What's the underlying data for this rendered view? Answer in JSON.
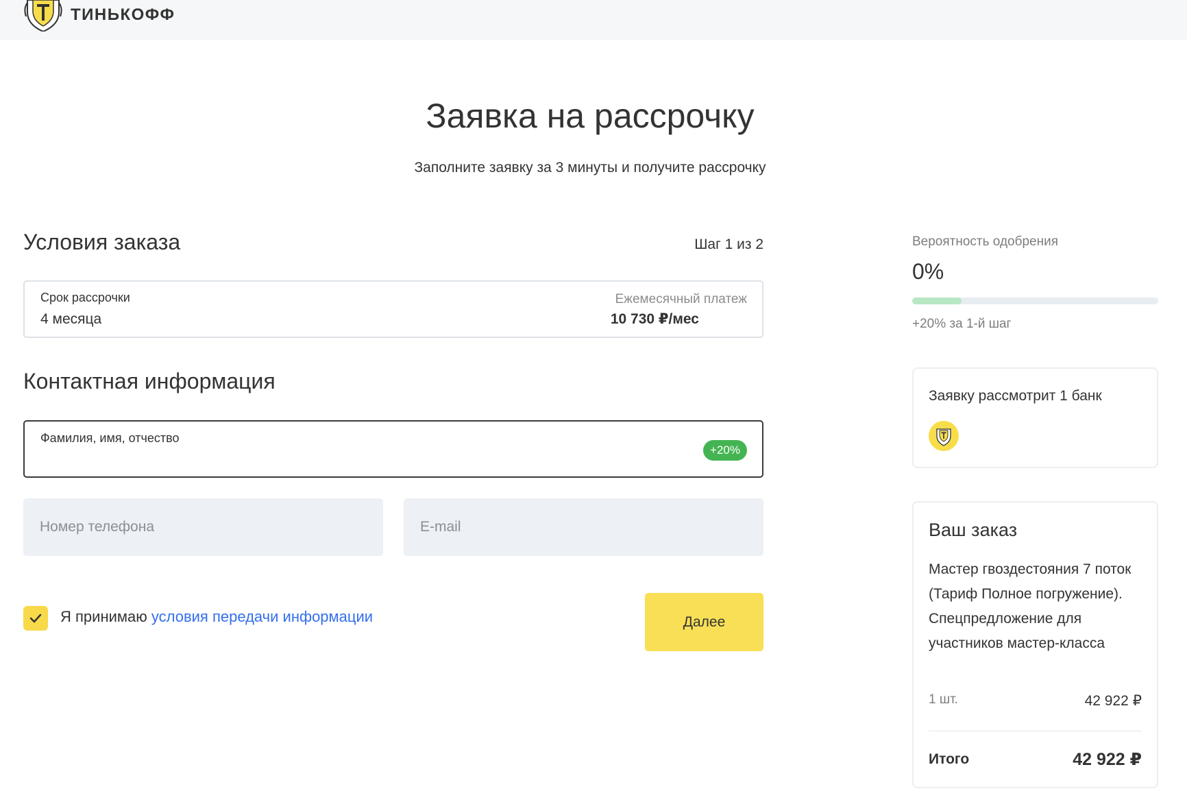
{
  "header": {
    "brand": "ТИНЬКОФФ",
    "logo_icon": "tinkoff-emblem-icon"
  },
  "page": {
    "title": "Заявка на рассрочку",
    "subtitle": "Заполните заявку за 3 минуты и получите рассрочку"
  },
  "order_conditions": {
    "heading": "Условия заказа",
    "step": "Шаг 1 из 2",
    "term_label": "Срок рассрочки",
    "term_value": "4 месяца",
    "monthly_label": "Ежемесячный платеж",
    "monthly_value": "10 730 ₽/мес"
  },
  "contact": {
    "heading": "Контактная информация",
    "fio_label": "Фамилия, имя, отчество",
    "fio_value": "",
    "fio_badge": "+20%",
    "phone_placeholder": "Номер телефона",
    "email_placeholder": "E-mail",
    "consent_text": "Я принимаю",
    "consent_link": "условия передачи информации",
    "consent_checked": true,
    "next_button": "Далее"
  },
  "approval": {
    "label": "Вероятность одобрения",
    "value": "0%",
    "progress_fraction": 0.2,
    "hint": "+20% за 1-й шаг",
    "progress_color": "#b7e7c3"
  },
  "bank_review": {
    "text": "Заявку рассмотрит 1 банк",
    "bank_icon": "tinkoff-bank-icon"
  },
  "order": {
    "title": "Ваш заказ",
    "description": "Мастер гвоздестояния 7 поток (Тариф Полное погружение). Спецпредложение для участников мастер-класса",
    "quantity": "1 шт.",
    "price": "42 922 ₽",
    "total_label": "Итого",
    "total_value": "42 922 ₽"
  },
  "colors": {
    "accent_yellow": "#f8df56",
    "link_blue": "#336fee",
    "badge_green": "#44b452",
    "field_grey": "#edf0f4"
  }
}
